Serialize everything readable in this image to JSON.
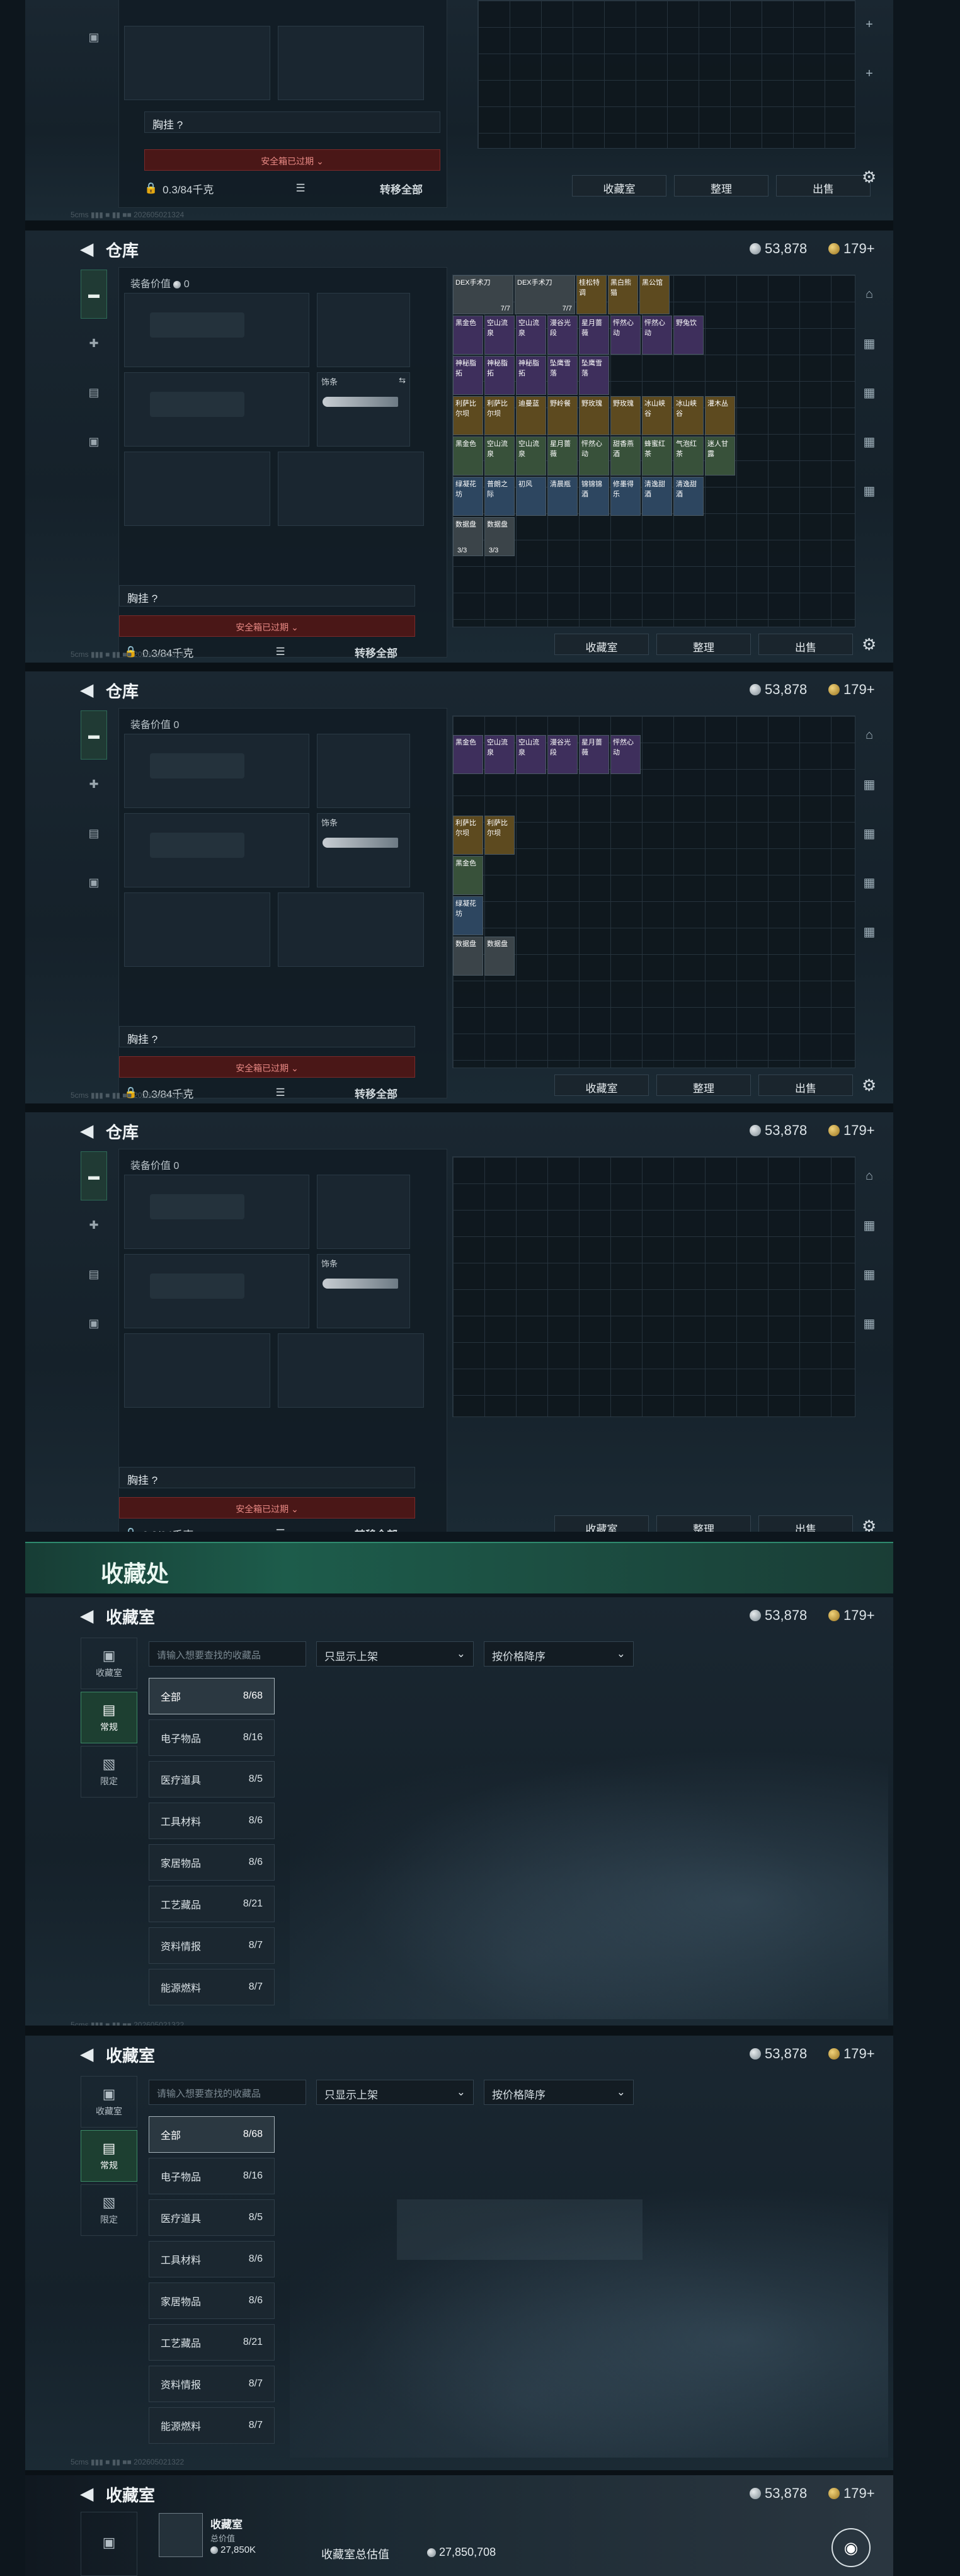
{
  "currency": {
    "silver": "53,878",
    "gold": "179+"
  },
  "top_partial": {
    "chest_label": "胸挂 ?",
    "warning": "安全箱已过期 ⌄",
    "capacity": "0.3/84千克",
    "transfer_all": "转移全部",
    "buttons": [
      "收藏室",
      "整理",
      "出售"
    ],
    "watermark": "5cms ▮▮▮ ■ ▮▮ ■■ 202605021324"
  },
  "warehouse": {
    "title": "仓库",
    "equip_value_label": "装备价值",
    "equip_value": "0",
    "melee_label": "饰条",
    "chest_label": "胸挂 ?",
    "warning": "安全箱已过期 ⌄",
    "capacity": "0.3/84千克",
    "transfer_all": "转移全部",
    "buttons": [
      "收藏室",
      "整理",
      "出售"
    ],
    "watermark": "5cms ▮▮▮ ■ ▮▮ ■■ 202605021324"
  },
  "items": [
    "DEX手术刀",
    "DEX手术刀",
    "7/7",
    "7/7",
    "桂松特调",
    "黑白熊猫",
    "黑公馆",
    "黑金色",
    "空山流泉",
    "空山流泉",
    "漫谷光段",
    "星月蔷薇",
    "怦然心动",
    "怦然心动",
    "野兔饮",
    "神秘脂拓",
    "神秘脂拓",
    "神秘脂拓",
    "坠鹰雪落",
    "坠鹰雪落",
    "利萨比尔坝",
    "利萨比尔坝",
    "迪曼蓝",
    "野岭餐",
    "野玫瑰",
    "野玫瑰",
    "冰山峡谷",
    "冰山峡谷",
    "灌木丛",
    "黑金色",
    "空山流泉",
    "空山流泉",
    "星月蔷薇",
    "怦然心动",
    "甜香燕酒",
    "蜂蜜红茶",
    "气泡红茶",
    "迷人甘露",
    "绿凝花坊",
    "普朗之际",
    "初风",
    "清晨瓶",
    "锦锦锦酒",
    "修墨得乐",
    "清逸甜酒",
    "清逸甜酒",
    "数据盘",
    "数据盘",
    "3/3",
    "3/3"
  ],
  "section_banner": "收藏处",
  "collection": {
    "title": "收藏室",
    "side": [
      {
        "label": "收藏室",
        "icon": "vault-icon"
      },
      {
        "label": "常规",
        "icon": "document-icon"
      },
      {
        "label": "限定",
        "icon": "image-icon"
      }
    ],
    "search_placeholder": "请输入想要查找的收藏品",
    "filter": "只显示上架",
    "sort": "按价格降序",
    "categories": [
      {
        "name": "全部",
        "count": "8/68"
      },
      {
        "name": "电子物品",
        "count": "8/16"
      },
      {
        "name": "医疗道具",
        "count": "8/5"
      },
      {
        "name": "工具材料",
        "count": "8/6"
      },
      {
        "name": "家居物品",
        "count": "8/6"
      },
      {
        "name": "工艺藏品",
        "count": "8/21"
      },
      {
        "name": "资料情报",
        "count": "8/7"
      },
      {
        "name": "能源燃料",
        "count": "8/7"
      }
    ],
    "watermark": "5cms ▮▮▮ ■ ▮▮ ■■ 202605021322"
  },
  "bottom": {
    "title": "收藏室",
    "room_label": "收藏室",
    "room_sub": "总价值",
    "room_value": "27,850K",
    "total_label": "收藏室总估值",
    "total_value": "27,850,708"
  },
  "colors": {
    "accent_green": "#2e8a6e",
    "warning_red": "#7b2a2a",
    "purple_item": "#3e2f5c",
    "orange_item": "#5d4a1f"
  }
}
